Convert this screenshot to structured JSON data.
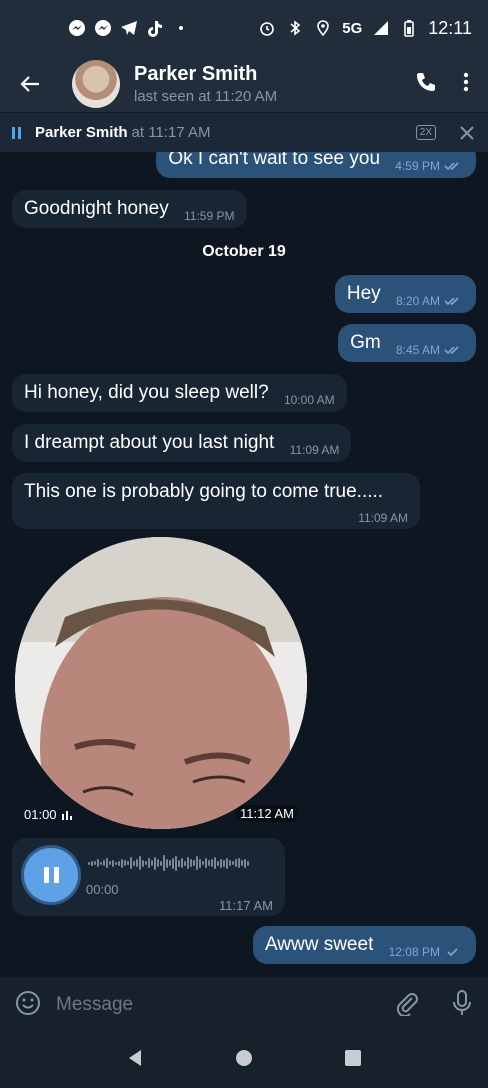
{
  "status_bar": {
    "network": "5G",
    "time": "12:11",
    "notification_icons": [
      "messenger-icon",
      "messenger-icon",
      "telegram-icon",
      "tiktok-icon",
      "dot-icon"
    ],
    "system_icons": [
      "alarm-icon",
      "bluetooth-icon",
      "location-icon",
      "signal-icon",
      "battery-icon"
    ]
  },
  "header": {
    "name": "Parker Smith",
    "status": "last seen at 11:20 AM"
  },
  "player": {
    "name": "Parker Smith",
    "time": "at 11:17 AM",
    "speed": "2X"
  },
  "messages": [
    {
      "dir": "out",
      "text": "Ok I can't wait to see you",
      "time": "4:59 PM",
      "read": true
    },
    {
      "dir": "in",
      "text": "Goodnight honey",
      "time": "11:59 PM"
    },
    {
      "dir": "out",
      "text": "Hey",
      "time": "8:20 AM",
      "read": true
    },
    {
      "dir": "out",
      "text": "Gm",
      "time": "8:45 AM",
      "read": true
    },
    {
      "dir": "in",
      "text": "Hi honey, did you sleep well?",
      "time": "10:00 AM"
    },
    {
      "dir": "in",
      "text": "I dreampt about you last night",
      "time": "11:09 AM"
    },
    {
      "dir": "in",
      "text": "This one is probably going to come true.....",
      "time": "11:09 AM"
    },
    {
      "dir": "out",
      "text": "Awww sweet",
      "time": "12:08 PM",
      "read": false
    }
  ],
  "date_separator": "October 19",
  "video_message": {
    "duration": "01:00",
    "time": "11:12 AM"
  },
  "voice_message": {
    "current": "00:00",
    "time": "11:17 AM"
  },
  "composer": {
    "placeholder": "Message"
  },
  "colors": {
    "background": "#0e1621",
    "incoming": "#182533",
    "outgoing": "#2b5278",
    "accent": "#5ea1e6"
  }
}
